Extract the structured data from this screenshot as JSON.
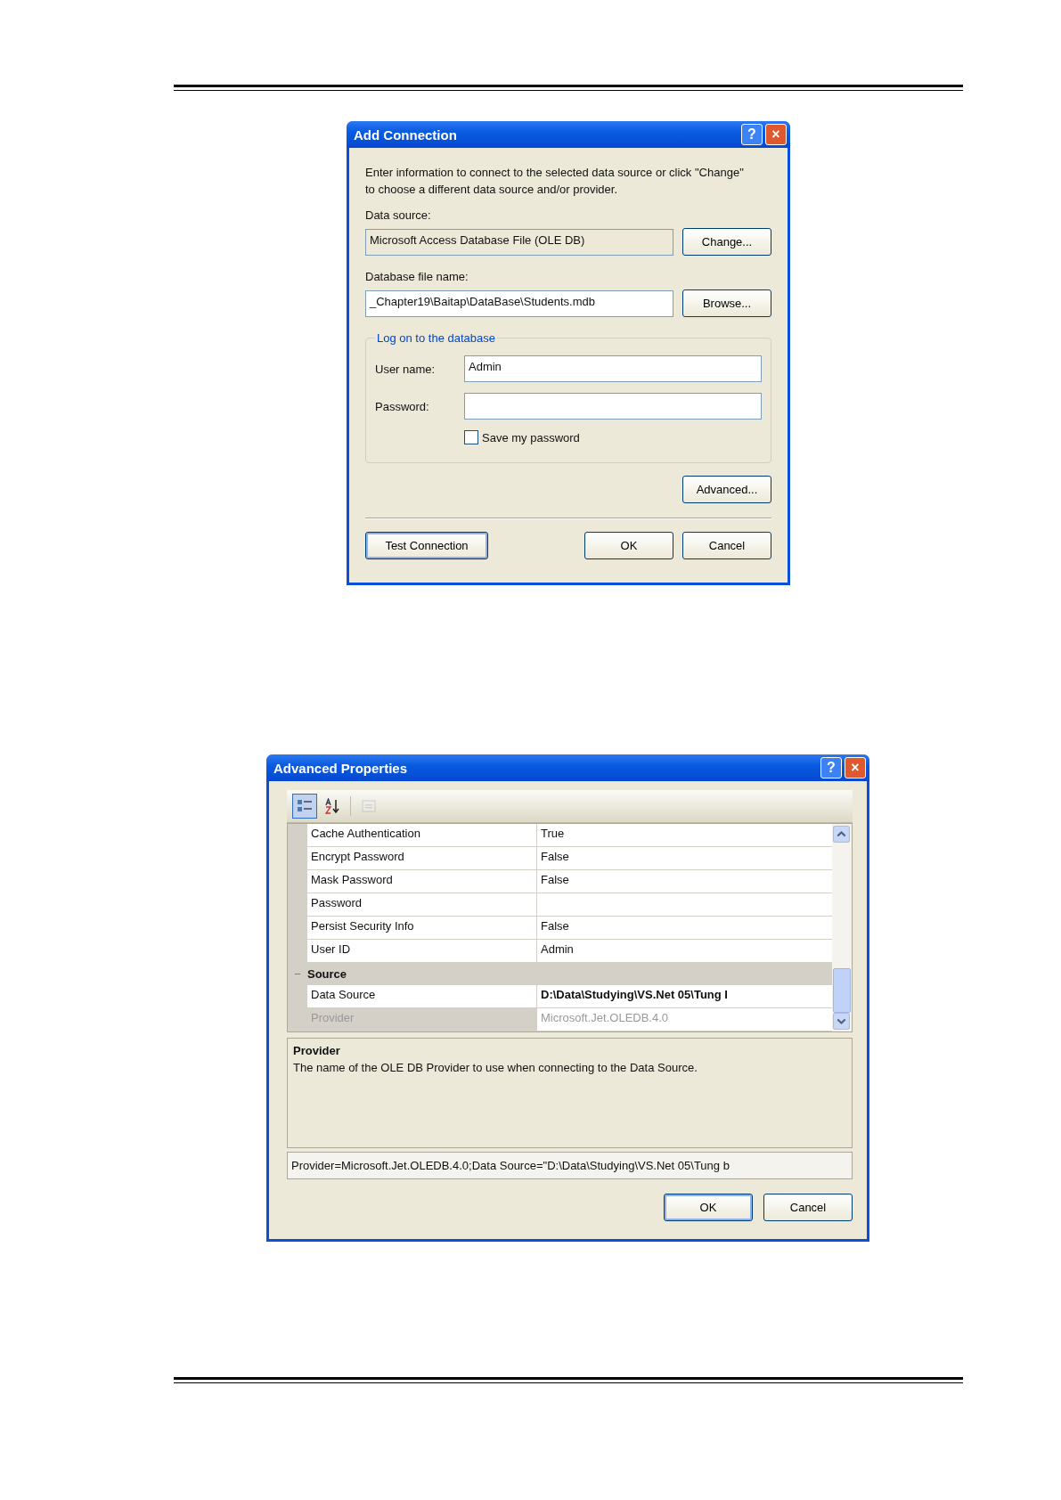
{
  "add_connection": {
    "window": {
      "title": "Add Connection",
      "help": "?",
      "close": "×"
    },
    "intro": "Enter information to connect to the selected data source or click \"Change\" to choose a different data source and/or provider.",
    "data_source": {
      "label": "Data source:",
      "value": "Microsoft Access Database File (OLE DB)",
      "button": "Change..."
    },
    "file_name": {
      "label": "Database file name:",
      "value": "_Chapter19\\Baitap\\DataBase\\Students.mdb",
      "button": "Browse..."
    },
    "logon": {
      "title": "Log on to the database",
      "user_label": "User name:",
      "user_value": "Admin",
      "password_label": "Password:",
      "save_password": {
        "label": "Save my password",
        "checked": false
      }
    },
    "advanced_button": "Advanced...",
    "buttons": [
      {
        "label": "Test Connection",
        "kind": "default"
      },
      {
        "label": "OK",
        "kind": "normal"
      },
      {
        "label": "Cancel",
        "kind": "normal"
      }
    ]
  },
  "advanced_properties": {
    "window": {
      "title": "Advanced Properties",
      "help": "?",
      "close": "×"
    },
    "toolbar": [
      {
        "kind": "categorized",
        "selected": true,
        "disabled": false
      },
      {
        "kind": "alphabetical",
        "selected": false,
        "disabled": false
      },
      {
        "kind": "pages",
        "selected": false,
        "disabled": true
      }
    ],
    "rows": [
      {
        "kind": "property",
        "name": "Cache Authentication",
        "value": "True",
        "selected": false,
        "modified": false
      },
      {
        "kind": "property",
        "name": "Encrypt Password",
        "value": "False",
        "selected": false,
        "modified": false
      },
      {
        "kind": "property",
        "name": "Mask Password",
        "value": "False",
        "selected": false,
        "modified": false
      },
      {
        "kind": "property",
        "name": "Password",
        "value": "",
        "selected": false
      },
      {
        "kind": "property",
        "name": "Persist Security Info",
        "value": "False",
        "selected": false,
        "modified": false
      },
      {
        "kind": "property",
        "name": "User ID",
        "value": "Admin",
        "selected": false,
        "modified": false
      },
      {
        "kind": "category",
        "name": "Source",
        "expander": "−",
        "expanded": true
      },
      {
        "kind": "property",
        "name": "Data Source",
        "value": "D:\\Data\\Studying\\VS.Net 05\\Tung I",
        "selected": false,
        "modified": true
      },
      {
        "kind": "property",
        "name": "Provider",
        "value": "Microsoft.Jet.OLEDB.4.0",
        "selected": true,
        "modified": false
      }
    ],
    "description": {
      "title": "Provider",
      "text": "The name of the OLE DB Provider to use when connecting to the Data Source."
    },
    "connection_string": "Provider=Microsoft.Jet.OLEDB.4.0;Data Source=\"D:\\Data\\Studying\\VS.Net 05\\Tung b",
    "buttons": [
      {
        "label": "OK",
        "kind": "default"
      },
      {
        "label": "Cancel",
        "kind": "normal"
      }
    ]
  }
}
